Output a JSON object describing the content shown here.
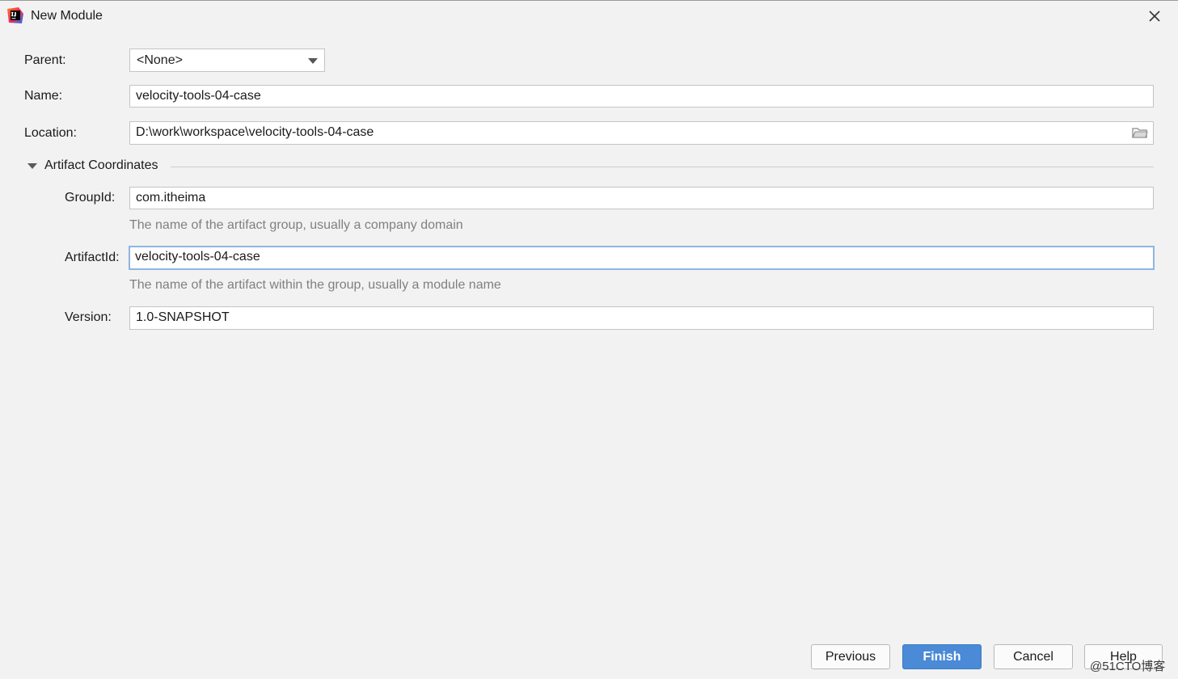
{
  "window": {
    "title": "New Module",
    "icon": "intellij-idea-icon",
    "close_icon": "close-icon"
  },
  "form": {
    "parent": {
      "label": "Parent:",
      "value": "<None>"
    },
    "name": {
      "label": "Name:",
      "value": "velocity-tools-04-case"
    },
    "location": {
      "label": "Location:",
      "value": "D:\\work\\workspace\\velocity-tools-04-case",
      "browse_icon": "folder-icon"
    }
  },
  "artifact": {
    "section_title": "Artifact Coordinates",
    "expanded": true,
    "group_id": {
      "label": "GroupId:",
      "value": "com.itheima",
      "hint": "The name of the artifact group, usually a company domain"
    },
    "artifact_id": {
      "label": "ArtifactId:",
      "value": "velocity-tools-04-case",
      "hint": "The name of the artifact within the group, usually a module name"
    },
    "version": {
      "label": "Version:",
      "value": "1.0-SNAPSHOT"
    }
  },
  "buttons": {
    "previous": "Previous",
    "finish": "Finish",
    "cancel": "Cancel",
    "help": "Help"
  },
  "watermark": "@51CTO博客",
  "colors": {
    "background": "#f2f2f2",
    "primary_button": "#4a8ad6",
    "focus_border": "#8fb5e0",
    "hint_text": "#808080"
  }
}
